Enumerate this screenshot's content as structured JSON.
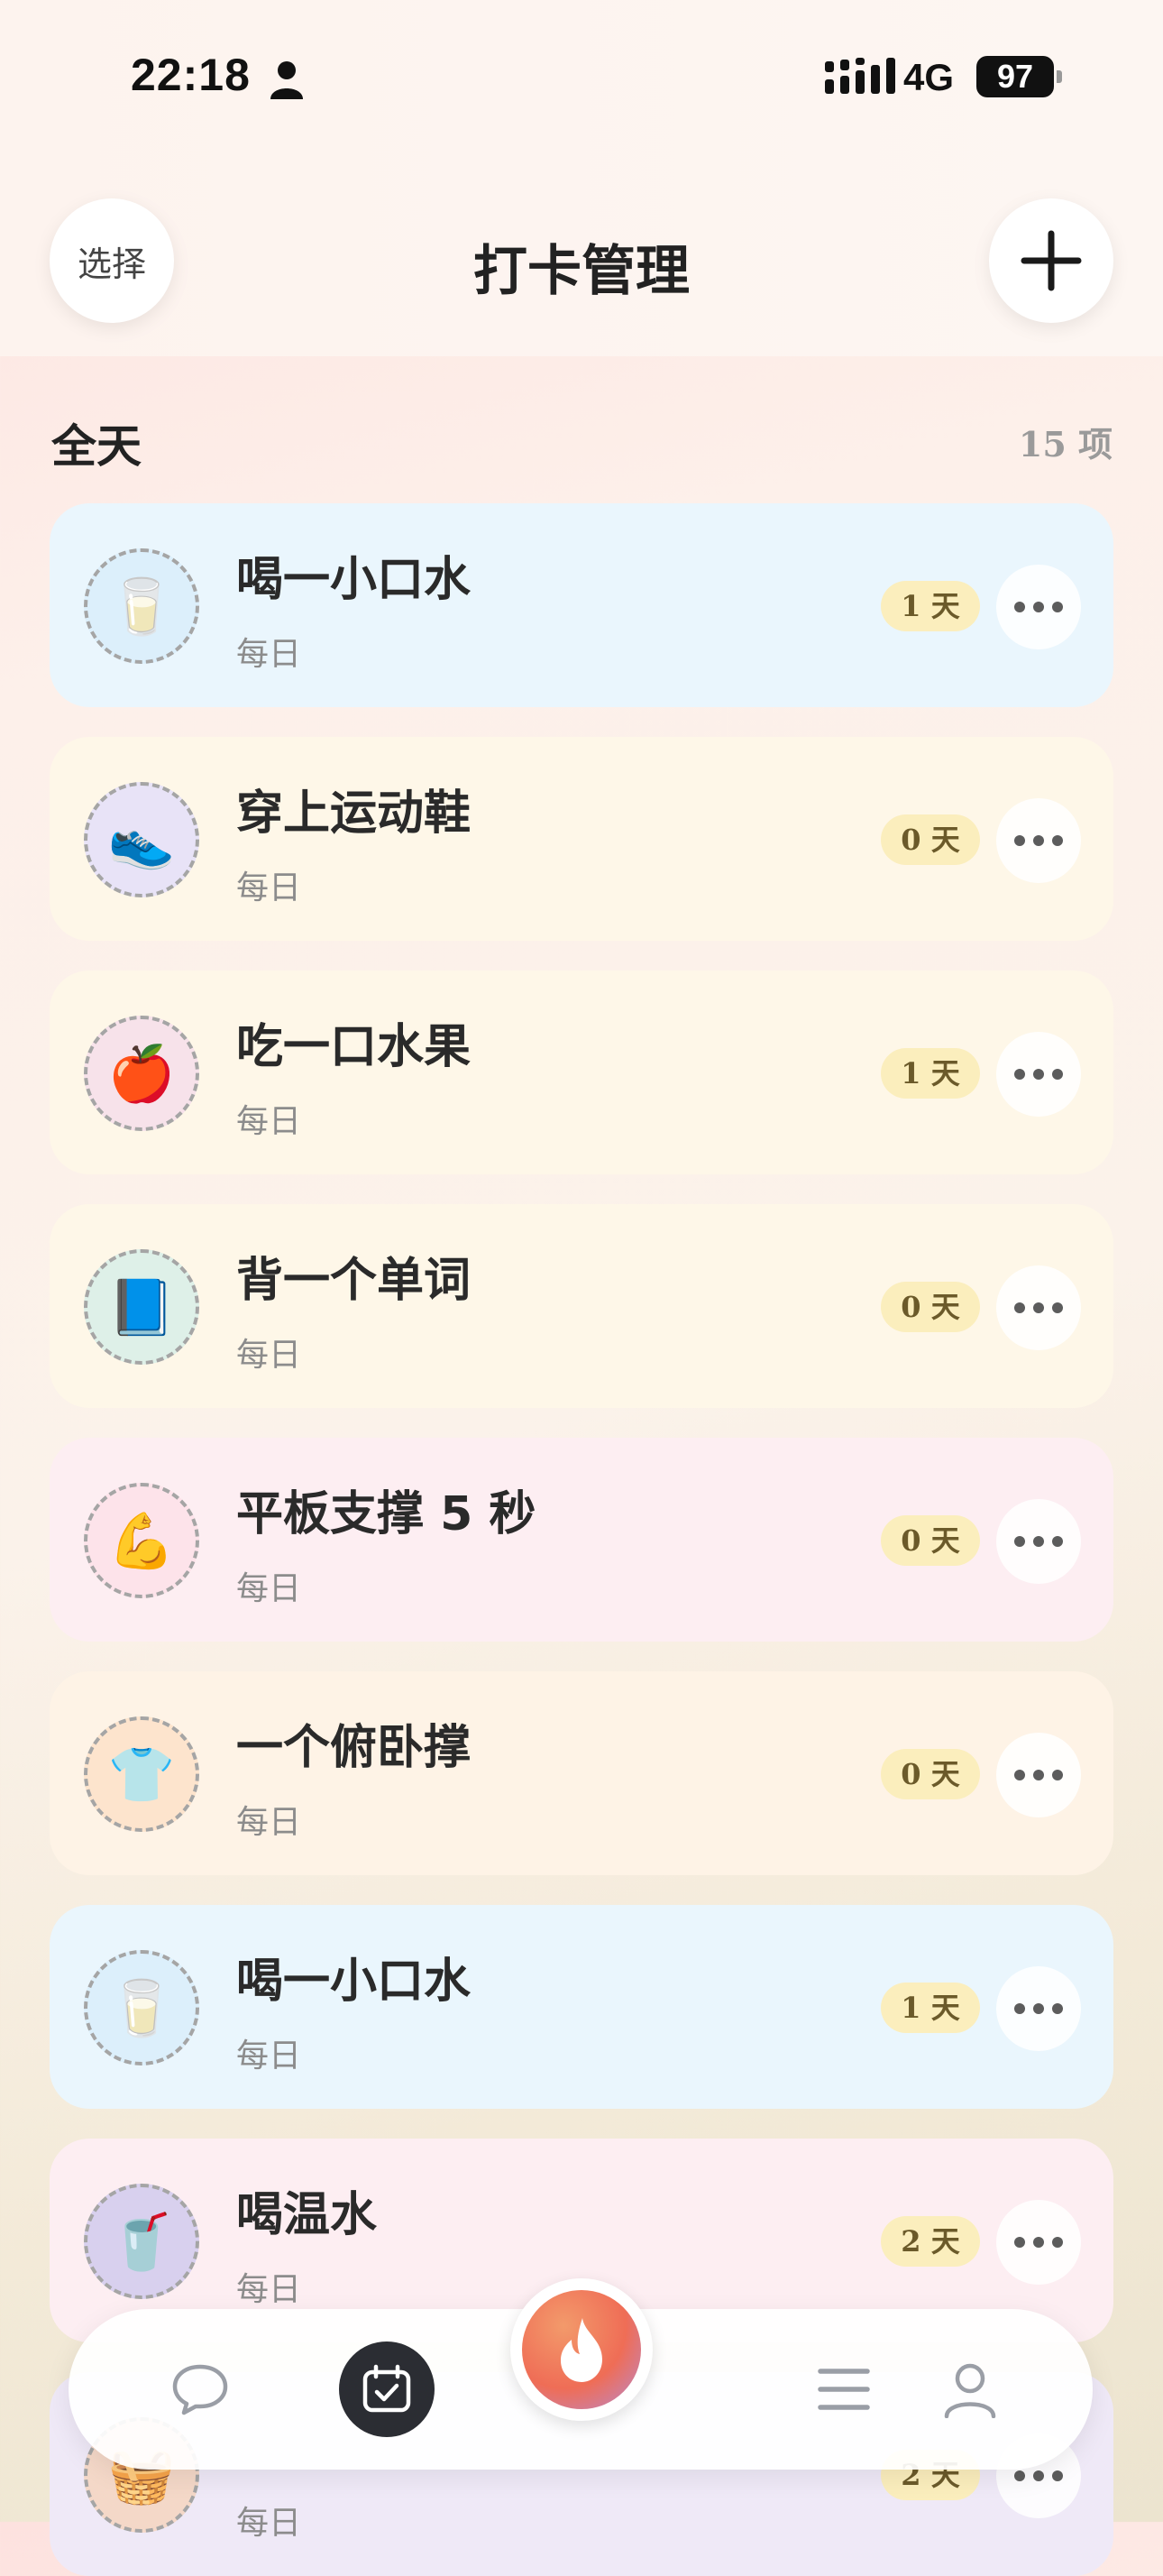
{
  "status_bar": {
    "time": "22:18",
    "network": "4G",
    "battery": "97"
  },
  "header": {
    "select_label": "选择",
    "title": "打卡管理"
  },
  "section": {
    "title": "全天",
    "count": "15 项"
  },
  "cards": [
    {
      "title": "喝一小口水",
      "sub": "每日",
      "days": "1 天",
      "icon": "milk-glass-icon",
      "emoji": "🥛",
      "bg": "#eaf6fd",
      "avatar_bg": "#dceffb"
    },
    {
      "title": "穿上运动鞋",
      "sub": "每日",
      "days": "0 天",
      "icon": "boy-tying-shoes-icon",
      "emoji": "👟",
      "bg": "#fef7e8",
      "avatar_bg": "#e8e3f7"
    },
    {
      "title": "吃一口水果",
      "sub": "每日",
      "days": "1 天",
      "icon": "boy-eating-fruit-icon",
      "emoji": "🍎",
      "bg": "#fef7e8",
      "avatar_bg": "#f7e2ea"
    },
    {
      "title": "背一个单词",
      "sub": "每日",
      "days": "0 天",
      "icon": "boy-reading-icon",
      "emoji": "📘",
      "bg": "#fef7e8",
      "avatar_bg": "#def0e8"
    },
    {
      "title": "平板支撑 5 秒",
      "sub": "每日",
      "days": "0 天",
      "icon": "flexed-biceps-icon",
      "emoji": "💪",
      "bg": "#fdeef2",
      "avatar_bg": "#fde3ea"
    },
    {
      "title": "一个俯卧撑",
      "sub": "每日",
      "days": "0 天",
      "icon": "shirt-icon",
      "emoji": "👕",
      "bg": "#fef3e6",
      "avatar_bg": "#fde4cd"
    },
    {
      "title": "喝一小口水",
      "sub": "每日",
      "days": "1 天",
      "icon": "milk-glass-icon",
      "emoji": "🥛",
      "bg": "#eaf6fd",
      "avatar_bg": "#dceffb"
    },
    {
      "title": "喝温水",
      "sub": "每日",
      "days": "2 天",
      "icon": "water-glass-icon",
      "emoji": "🥤",
      "bg": "#fdeef2",
      "avatar_bg": "#d8d0ee"
    },
    {
      "title": "",
      "sub": "每日",
      "days": "2 天",
      "icon": "shopping-basket-icon",
      "emoji": "🧺",
      "bg": "#efe9f7",
      "avatar_bg": "#f4d8c8"
    }
  ],
  "tabs": [
    "chat-icon",
    "checkin-calendar-icon",
    "flame-icon",
    "list-icon",
    "profile-icon"
  ],
  "colors": {
    "accent": "#ef6d56",
    "badge": "#fbeebd",
    "tab_active": "#2b2d33"
  }
}
